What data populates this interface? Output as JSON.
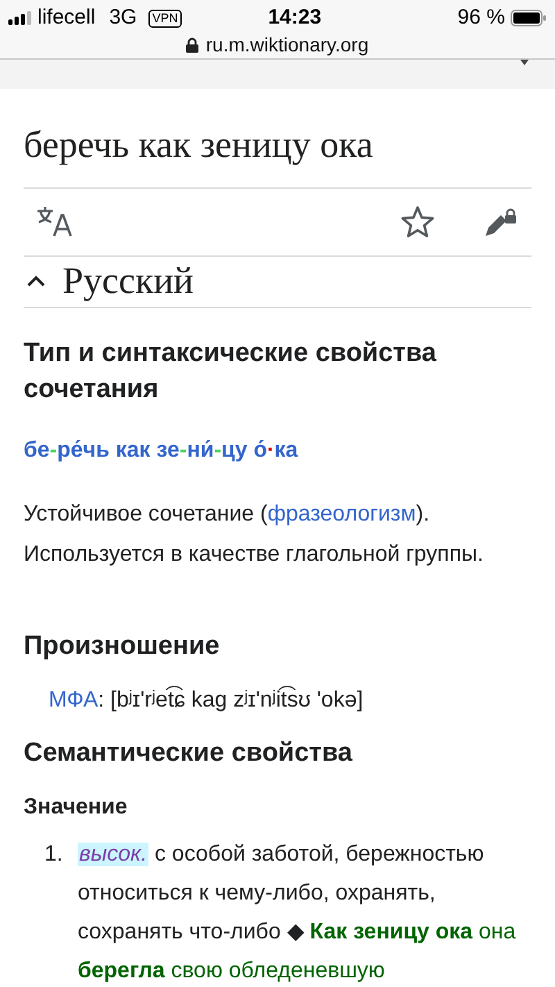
{
  "status_bar": {
    "carrier": "lifecell",
    "network": "3G",
    "vpn": "VPN",
    "time": "14:23",
    "battery": "96 %"
  },
  "address_bar": {
    "url": "ru.m.wiktionary.org"
  },
  "page": {
    "title": "беречь как зеницу ока",
    "section": {
      "title": "Русский",
      "expanded": true
    },
    "type_heading": "Тип и синтаксические свойства сочетания",
    "hyphenation": [
      {
        "text": "бе",
        "kind": "syllable"
      },
      {
        "text": "-",
        "kind": "hyphen"
      },
      {
        "text": "ре́чь как зе",
        "kind": "syllable"
      },
      {
        "text": "-",
        "kind": "hyphen"
      },
      {
        "text": "ни́",
        "kind": "syllable"
      },
      {
        "text": "-",
        "kind": "hyphen"
      },
      {
        "text": "цу о́",
        "kind": "syllable"
      },
      {
        "text": "·",
        "kind": "dot"
      },
      {
        "text": "ка",
        "kind": "syllable"
      }
    ],
    "description": [
      {
        "text": "Устойчивое сочетание (",
        "kind": "text"
      },
      {
        "text": "фразеологизм",
        "kind": "link"
      },
      {
        "text": ").",
        "kind": "text"
      }
    ],
    "usage": "Используется в качестве глагольной группы.",
    "pronunciation_heading": "Произношение",
    "ipa_label": "МФА",
    "ipa": ": [bʲɪ'rʲet͡ɕ kag zʲɪ'nʲit͡sʊ 'okə]",
    "semantics_heading": "Семантические свойства",
    "meaning_heading": "Значение",
    "meanings": [
      {
        "number": "1.",
        "label": "высок.",
        "definition": "с особой заботой, бережностью относиться к чему-либо, охранять, сохранять что-либо",
        "separator": "◆",
        "example": "**Как зеницу ока** она **берегла** свою обледеневшую"
      }
    ]
  }
}
